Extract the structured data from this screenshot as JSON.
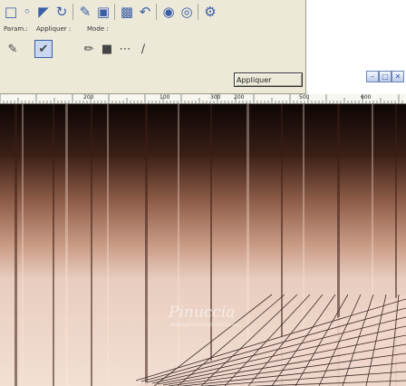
{
  "toolbar": {
    "labels": {
      "param": "Param.:",
      "apply_to": "Appliquer :",
      "mode": "Mode :"
    },
    "apply_button": "Appliquer"
  },
  "ruler": {
    "ticks": [
      "200",
      "100",
      "300",
      "200",
      "500",
      "600"
    ]
  },
  "watermark": {
    "title": "Pinuccia",
    "subtitle": "www.pinucciapinuccia.eu"
  },
  "colors": {
    "panel": "#ece9d8",
    "accent": "#3b5ea8"
  }
}
